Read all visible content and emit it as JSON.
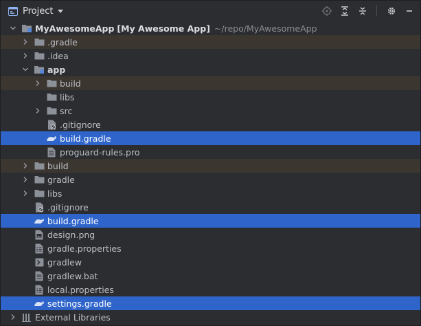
{
  "header": {
    "title": "Project",
    "icons": [
      "project-view-icon",
      "chevron-down-icon",
      "locate-file-icon",
      "expand-all-icon",
      "collapse-all-icon",
      "gear-icon",
      "minimize-icon"
    ]
  },
  "tree": {
    "root": {
      "name": "MyAwesomeApp",
      "module": "[My Awesome App]",
      "path": "~/repo/MyAwesomeApp"
    },
    "items": [
      {
        "label": ".gradle"
      },
      {
        "label": ".idea"
      },
      {
        "label": "app"
      },
      {
        "label": "build"
      },
      {
        "label": "libs"
      },
      {
        "label": "src"
      },
      {
        "label": ".gitignore"
      },
      {
        "label": "build.gradle"
      },
      {
        "label": "proguard-rules.pro"
      },
      {
        "label": "build"
      },
      {
        "label": "gradle"
      },
      {
        "label": "libs"
      },
      {
        "label": ".gitignore"
      },
      {
        "label": "build.gradle"
      },
      {
        "label": "design.png"
      },
      {
        "label": "gradle.properties"
      },
      {
        "label": "gradlew"
      },
      {
        "label": "gradlew.bat"
      },
      {
        "label": "local.properties"
      },
      {
        "label": "settings.gradle"
      },
      {
        "label": "External Libraries"
      }
    ]
  },
  "colors": {
    "background": "#2b2d30",
    "selection": "#2f65ca",
    "excluded": "#3c3631"
  }
}
